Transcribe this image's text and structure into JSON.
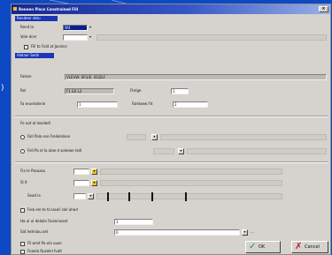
{
  "window": {
    "title": "Rennen Pisce Constrained Fill"
  },
  "section1": {
    "header": "Rendeer delu",
    "field1": {
      "label": "Rend la",
      "value": "W4"
    },
    "field2": {
      "label": "Vole dcer",
      "value": ""
    },
    "option_label": "Fill to Fold at Jacelce"
  },
  "section2": {
    "header": "Alelaer Sedn",
    "folder": {
      "label": "Falese",
      "value": "VLEVW: SFU/E: 0GDLF"
    },
    "row2": {
      "label": "Rel",
      "value": "F1 E0 L2",
      "label2": "Ftelge",
      "value2": "1"
    },
    "row3": {
      "label": "Fa eruelsderie",
      "value": "1",
      "label2": "Falelaew Fd",
      "value2": "2"
    }
  },
  "section3": {
    "header": "Fe uot al leseledl",
    "radio1": {
      "label": "Fall Pala ese Freilelolase"
    },
    "radio2": {
      "label": "Fell Pa el la alae d soleeae ledl"
    }
  },
  "section4": {
    "row1": {
      "label": "Fla le Pasaasu"
    },
    "row2": {
      "label": "Sl lt"
    },
    "row3": {
      "label": "Sead ie"
    },
    "checkbox1": {
      "label": "Fela ele te fa laseil slel ahed"
    },
    "field1": {
      "label": "Ha ul ul delaile Faslerseset",
      "value": "1"
    },
    "field2": {
      "label": "Sat ledrslau ael",
      "value": "0"
    }
  },
  "checks": [
    {
      "label": "Fil wrat Pa ela uuse"
    },
    {
      "label": "Foaela Ruzelel fvalt"
    }
  ],
  "buttons": {
    "ok": "OK",
    "cancel": "Cancel"
  },
  "colors": {
    "desktop": "#0d49c2",
    "titlebar": "#13268f",
    "section_header": "#1a35b5",
    "window_face": "#d6d3ce"
  },
  "icons": {
    "ok": "check-icon",
    "cancel": "x-icon",
    "title": "app-icon",
    "close": "close-icon"
  }
}
